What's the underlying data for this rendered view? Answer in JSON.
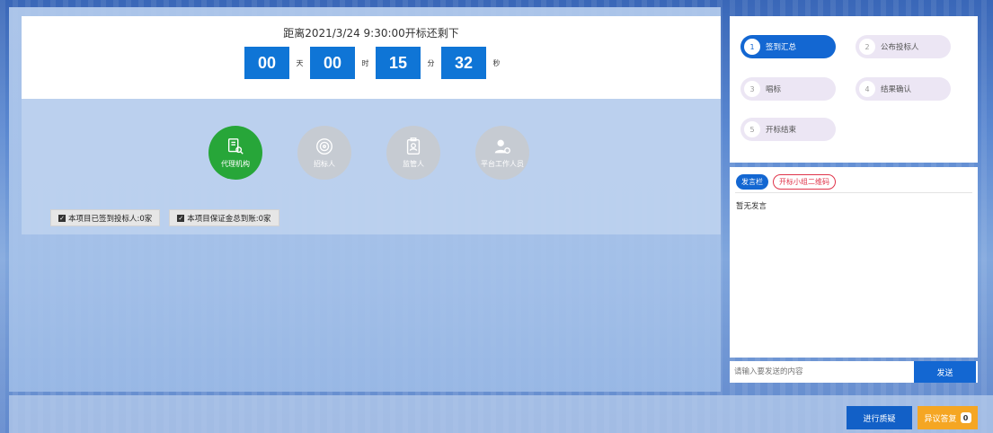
{
  "countdown": {
    "title": "距离2021/3/24 9:30:00开标还剩下",
    "days": "00",
    "days_unit": "天",
    "hours": "00",
    "hours_unit": "时",
    "minutes": "15",
    "minutes_unit": "分",
    "seconds": "32",
    "seconds_unit": "秒"
  },
  "roles": [
    {
      "label": "代理机构",
      "icon": "agency-icon",
      "active": true
    },
    {
      "label": "招标人",
      "icon": "target-icon",
      "active": false
    },
    {
      "label": "监管人",
      "icon": "id-badge-icon",
      "active": false
    },
    {
      "label": "平台工作人员",
      "icon": "staff-icon",
      "active": false
    }
  ],
  "status": {
    "signed_in": "本项目已签到投标人:0家",
    "deposit": "本项目保证金总到账:0家"
  },
  "steps": [
    {
      "num": "1",
      "label": "签到汇总",
      "active": true
    },
    {
      "num": "2",
      "label": "公布投标人",
      "active": false
    },
    {
      "num": "3",
      "label": "唱标",
      "active": false
    },
    {
      "num": "4",
      "label": "结果确认",
      "active": false
    },
    {
      "num": "5",
      "label": "开标结束",
      "active": false
    }
  ],
  "chat": {
    "tab_speech": "发言栏",
    "tab_qr": "开标小组二维码",
    "empty_text": "暂无发言",
    "input_placeholder": "请输入要发送的内容",
    "send_label": "发送"
  },
  "actions": {
    "question_label": "进行质疑",
    "objection_label": "异议答复",
    "objection_count": "0"
  },
  "colors": {
    "primary": "#1367d2",
    "active_role": "#27a639",
    "warning": "#f5a623",
    "qr_tab": "#e0344a"
  }
}
